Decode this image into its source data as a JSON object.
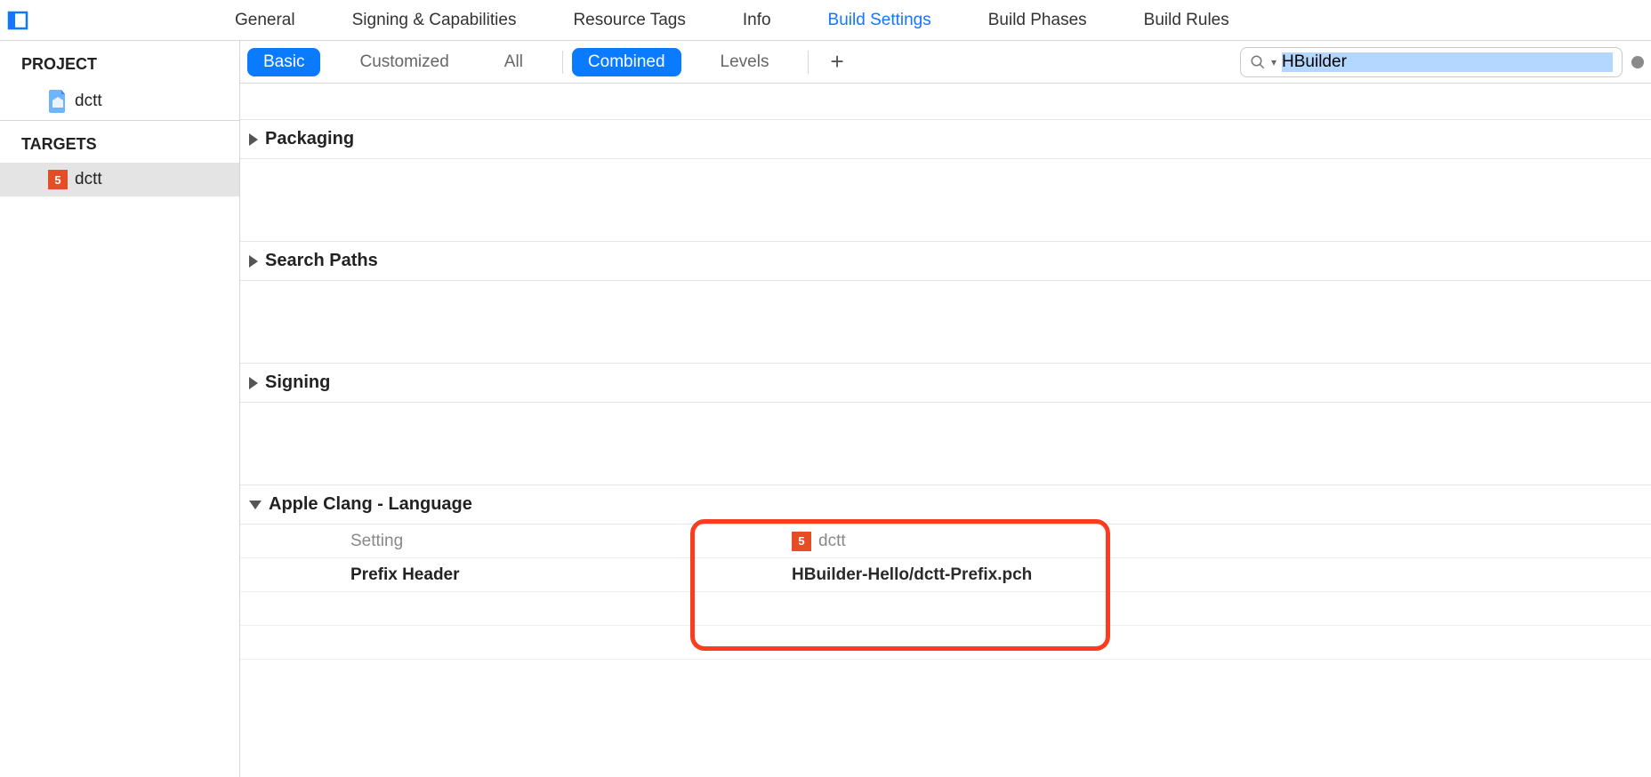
{
  "tabs": {
    "general": "General",
    "signing": "Signing & Capabilities",
    "resource_tags": "Resource Tags",
    "info": "Info",
    "build_settings": "Build Settings",
    "build_phases": "Build Phases",
    "build_rules": "Build Rules"
  },
  "sidebar": {
    "project_header": "PROJECT",
    "project_name": "dctt",
    "targets_header": "TARGETS",
    "target_name": "dctt"
  },
  "filter": {
    "basic": "Basic",
    "customized": "Customized",
    "all": "All",
    "combined": "Combined",
    "levels": "Levels",
    "search_value": "HBuilder"
  },
  "sections": {
    "packaging": "Packaging",
    "search_paths": "Search Paths",
    "signing": "Signing",
    "apple_clang": "Apple Clang - Language"
  },
  "clang": {
    "setting_head": "Setting",
    "target_name": "dctt",
    "prefix_header_label": "Prefix Header",
    "prefix_header_value": "HBuilder-Hello/dctt-Prefix.pch"
  }
}
